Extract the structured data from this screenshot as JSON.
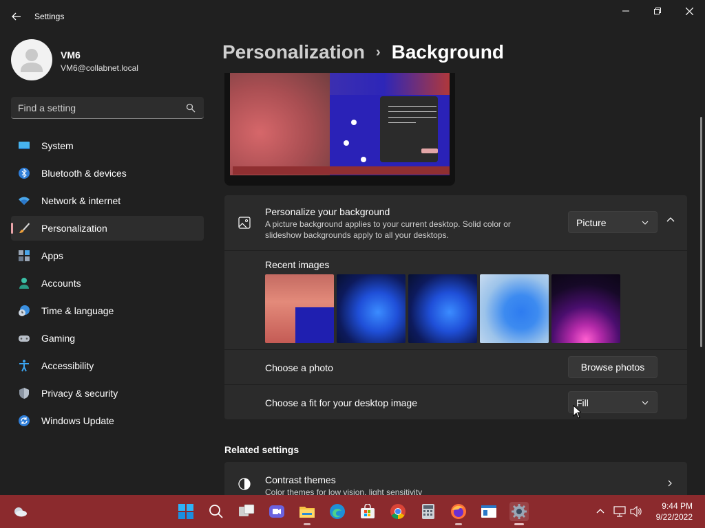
{
  "window": {
    "title": "Settings"
  },
  "profile": {
    "name": "VM6",
    "email": "VM6@collabnet.local"
  },
  "search": {
    "placeholder": "Find a setting"
  },
  "nav": {
    "items": [
      {
        "label": "System",
        "icon": "system-icon"
      },
      {
        "label": "Bluetooth & devices",
        "icon": "bluetooth-icon"
      },
      {
        "label": "Network & internet",
        "icon": "wifi-icon"
      },
      {
        "label": "Personalization",
        "icon": "brush-icon",
        "active": true
      },
      {
        "label": "Apps",
        "icon": "apps-icon"
      },
      {
        "label": "Accounts",
        "icon": "person-icon"
      },
      {
        "label": "Time & language",
        "icon": "clock-globe-icon"
      },
      {
        "label": "Gaming",
        "icon": "gamepad-icon"
      },
      {
        "label": "Accessibility",
        "icon": "accessibility-icon"
      },
      {
        "label": "Privacy & security",
        "icon": "shield-icon"
      },
      {
        "label": "Windows Update",
        "icon": "update-icon"
      }
    ]
  },
  "breadcrumb": {
    "parent": "Personalization",
    "separator": "›",
    "current": "Background"
  },
  "personalize": {
    "title": "Personalize your background",
    "description": "A picture background applies to your current desktop. Solid color or slideshow backgrounds apply to all your desktops.",
    "selected": "Picture"
  },
  "recent": {
    "title": "Recent images"
  },
  "photo": {
    "title": "Choose a photo",
    "button": "Browse photos"
  },
  "fit": {
    "title": "Choose a fit for your desktop image",
    "selected": "Fill"
  },
  "related": {
    "title": "Related settings",
    "contrast_title": "Contrast themes",
    "contrast_desc": "Color themes for low vision, light sensitivity"
  },
  "taskbar": {
    "time": "9:44 PM",
    "date": "9/22/2022"
  },
  "colors": {
    "accent": "#e8a3a8",
    "taskbar": "#8b2a2d",
    "background": "#202020",
    "card": "#2b2b2b"
  }
}
